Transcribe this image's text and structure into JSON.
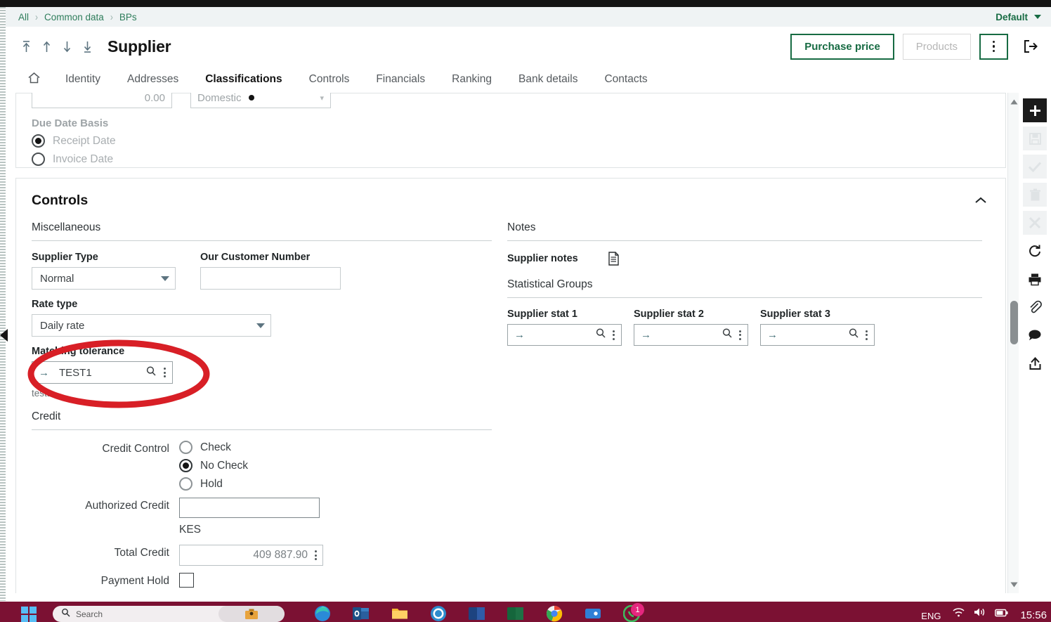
{
  "breadcrumb": {
    "items": [
      "All",
      "Common data",
      "BPs"
    ],
    "separator": "›",
    "right_label": "Default"
  },
  "header": {
    "title": "Supplier",
    "nav_icons": [
      "first-record-icon",
      "previous-record-icon",
      "next-record-icon",
      "last-record-icon"
    ],
    "purchase_price_label": "Purchase price",
    "products_label": "Products",
    "kebab_name": "more-actions-icon",
    "exit_name": "exit-icon"
  },
  "tabs": [
    {
      "label": "",
      "name": "home-tab",
      "icon": "home-icon",
      "active": false
    },
    {
      "label": "Identity",
      "name": "tab-identity",
      "active": false
    },
    {
      "label": "Addresses",
      "name": "tab-addresses",
      "active": false
    },
    {
      "label": "Classifications",
      "name": "tab-classifications",
      "active": true
    },
    {
      "label": "Controls",
      "name": "tab-controls",
      "active": false
    },
    {
      "label": "Financials",
      "name": "tab-financials",
      "active": false
    },
    {
      "label": "Ranking",
      "name": "tab-ranking",
      "active": false
    },
    {
      "label": "Bank details",
      "name": "tab-bank-details",
      "active": false
    },
    {
      "label": "Contacts",
      "name": "tab-contacts",
      "active": false
    }
  ],
  "cut_card": {
    "numeric_value": "0.00",
    "select_value": "Domestic",
    "due_date_basis_label": "Due Date Basis",
    "options": [
      {
        "label": "Receipt Date",
        "checked": true
      },
      {
        "label": "Invoice Date",
        "checked": false
      }
    ]
  },
  "controls": {
    "title": "Controls",
    "miscellaneous": {
      "section_label": "Miscellaneous",
      "supplier_type_label": "Supplier Type",
      "supplier_type_value": "Normal",
      "our_customer_number_label": "Our Customer Number",
      "our_customer_number_value": "",
      "rate_type_label": "Rate type",
      "rate_type_value": "Daily rate",
      "matching_tolerance_label": "Matching tolerance",
      "matching_tolerance_value": "TEST1",
      "matching_tolerance_help": "test1"
    },
    "credit": {
      "section_label": "Credit",
      "credit_control_label": "Credit Control",
      "credit_control_options": [
        {
          "label": "Check",
          "checked": false
        },
        {
          "label": "No Check",
          "checked": true
        },
        {
          "label": "Hold",
          "checked": false
        }
      ],
      "authorized_credit_label": "Authorized Credit",
      "authorized_credit_value": "",
      "currency": "KES",
      "total_credit_label": "Total Credit",
      "total_credit_value": "409 887.90",
      "payment_hold_label": "Payment Hold",
      "payment_hold_checked": false
    },
    "notes": {
      "section_label": "Notes",
      "supplier_notes_label": "Supplier notes",
      "notes_icon": "document-icon"
    },
    "statistical_groups": {
      "section_label": "Statistical Groups",
      "fields": [
        {
          "label": "Supplier stat 1",
          "value": ""
        },
        {
          "label": "Supplier stat 2",
          "value": ""
        },
        {
          "label": "Supplier stat 3",
          "value": ""
        }
      ]
    }
  },
  "icon_rail": [
    {
      "name": "add-icon",
      "state": "primary"
    },
    {
      "name": "save-icon",
      "state": "disabled"
    },
    {
      "name": "validate-check-icon",
      "state": "disabled"
    },
    {
      "name": "delete-trash-icon",
      "state": "disabled"
    },
    {
      "name": "cancel-close-icon",
      "state": "disabled"
    },
    {
      "name": "refresh-icon",
      "state": "enabled"
    },
    {
      "name": "print-icon",
      "state": "enabled"
    },
    {
      "name": "attachment-icon",
      "state": "enabled"
    },
    {
      "name": "comment-icon",
      "state": "enabled"
    },
    {
      "name": "share-export-icon",
      "state": "enabled"
    }
  ],
  "taskbar": {
    "search_placeholder": "Search",
    "language": "ENG",
    "time": "15:56",
    "notification_count": "1"
  },
  "colors": {
    "accent_green": "#176b43",
    "annotation_red": "#d81f26",
    "taskbar": "#7b1133"
  }
}
